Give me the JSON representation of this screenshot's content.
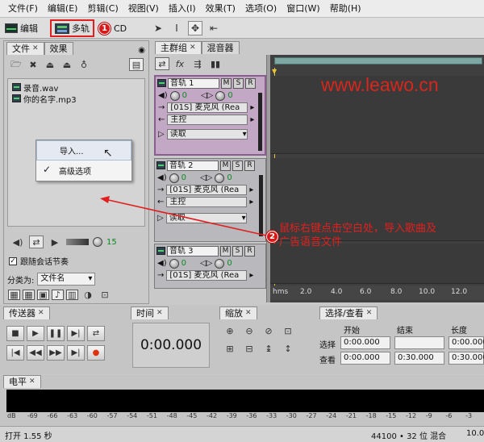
{
  "menubar": {
    "items": [
      "文件(F)",
      "编辑(E)",
      "剪辑(C)",
      "视图(V)",
      "插入(I)",
      "效果(T)",
      "选项(O)",
      "窗口(W)",
      "帮助(H)"
    ]
  },
  "toolbar": {
    "edit_label": "编辑",
    "multitrack_label": "多轨",
    "cd_label": "CD",
    "badge1": "1"
  },
  "left_panel": {
    "tabs": [
      "文件",
      "效果"
    ],
    "files": [
      "录音.wav",
      "你的名字.mp3"
    ],
    "context_menu": {
      "items": [
        "导入...",
        "高级选项"
      ],
      "checked_item": "高级选项"
    },
    "level_value": "15",
    "follow_session_label": "跟随会话节奏",
    "sort_label": "分类为:",
    "sort_value": "文件名"
  },
  "tracks_panel": {
    "tabs": [
      "主群组",
      "混音器"
    ],
    "tracks": [
      {
        "name": "音轨 1",
        "vol": "0",
        "pan": "0",
        "input": "[01S] 麦克风 (Rea",
        "output": "主控",
        "automation": "读取"
      },
      {
        "name": "音轨 2",
        "vol": "0",
        "pan": "0",
        "input": "[01S] 麦克风 (Rea",
        "output": "主控",
        "automation": "读取"
      },
      {
        "name": "音轨 3",
        "vol": "0",
        "pan": "0",
        "input": "[01S] 麦克风 (Rea"
      }
    ],
    "ruler_labels": [
      "hms",
      "2.0",
      "4.0",
      "6.0",
      "8.0",
      "10.0",
      "12.0"
    ]
  },
  "annotation": {
    "watermark": "www.leawo.cn",
    "badge2": "2",
    "text": "鼠标右键点击空白处，导入歌曲及广告语音文件"
  },
  "transport": {
    "title": "传送器"
  },
  "time_panel": {
    "title": "时间",
    "value": "0:00.000"
  },
  "zoom_panel": {
    "title": "缩放"
  },
  "selection_panel": {
    "title": "选择/查看",
    "headers": [
      "开始",
      "结束",
      "长度"
    ],
    "rows": [
      {
        "label": "选择",
        "start": "0:00.000",
        "end": "",
        "length": "0:00.000"
      },
      {
        "label": "查看",
        "start": "0:00.000",
        "end": "0:30.000",
        "length": "0:30.000"
      }
    ]
  },
  "level_meter": {
    "title": "电平",
    "scale": [
      "dB",
      "-69",
      "-66",
      "-63",
      "-60",
      "-57",
      "-54",
      "-51",
      "-48",
      "-45",
      "-42",
      "-39",
      "-36",
      "-33",
      "-30",
      "-27",
      "-24",
      "-21",
      "-18",
      "-15",
      "-12",
      "-9",
      "-6",
      "-3"
    ]
  },
  "status": {
    "left": "打开 1.55 秒",
    "right": "44100 • 32 位 混合",
    "far_right": "10.0"
  },
  "colors": {
    "annotation_red": "#e0201e",
    "watermark_red": "#d9261c",
    "selected_track": "#c3a8c6"
  }
}
